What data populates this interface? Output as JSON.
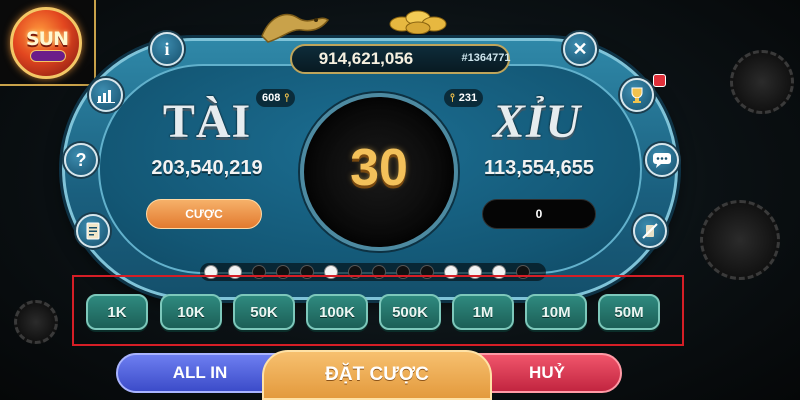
{
  "jackpot": {
    "value": "914,621,056",
    "session_id": "#1364771"
  },
  "tai": {
    "title": "TÀI",
    "players": "608",
    "total": "203,540,219",
    "bet_label": "CƯỢC"
  },
  "xiu": {
    "title": "XỈU",
    "players": "231",
    "total": "113,554,655",
    "bet_value": "0"
  },
  "countdown": "30",
  "logo": {
    "text": "SUN"
  },
  "side_buttons": {
    "info": "i",
    "close": "✕",
    "stats": "▥",
    "leaderboard": "🏆",
    "help": "?",
    "chat": "💬",
    "history": "▤",
    "mute": "⁄"
  },
  "history": [
    "white",
    "white",
    "black",
    "black",
    "black",
    "white",
    "black",
    "black",
    "black",
    "black",
    "white",
    "white",
    "white",
    "black"
  ],
  "chips": [
    "1K",
    "10K",
    "50K",
    "100K",
    "500K",
    "1M",
    "10M",
    "50M"
  ],
  "actions": {
    "all_in": "ALL IN",
    "confirm": "ĐẶT CƯỢC",
    "cancel": "HUỶ"
  },
  "colors": {
    "table": "#1a5f7e",
    "chip": "#2f8a7f",
    "countdown": "#f3c15a",
    "all_in": "#4f5fdc",
    "confirm": "#efae54",
    "cancel": "#d83a52",
    "highlight_frame": "#d51e26"
  }
}
